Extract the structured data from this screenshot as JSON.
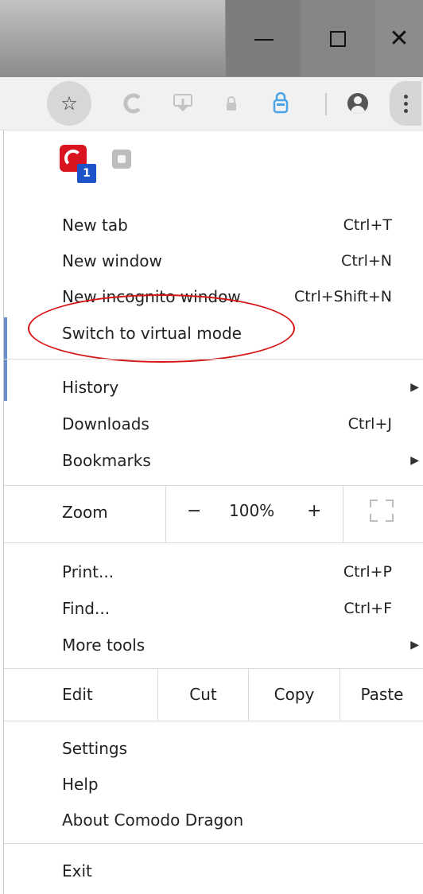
{
  "window": {
    "minimize_icon": "minimize-icon",
    "maximize_icon": "maximize-icon",
    "close_glyph": "✕"
  },
  "toolbar": {
    "star_glyph": "☆",
    "icons": [
      "refresh-icon",
      "download-icon",
      "lock-icon",
      "shield-icon",
      "account-icon",
      "menu-icon"
    ]
  },
  "extensions": {
    "badge": "1"
  },
  "menu": {
    "group1": [
      {
        "label": "New tab",
        "shortcut": "Ctrl+T"
      },
      {
        "label": "New window",
        "shortcut": "Ctrl+N"
      },
      {
        "label": "New incognito window",
        "shortcut": "Ctrl+Shift+N"
      },
      {
        "label": "Switch to virtual mode",
        "shortcut": ""
      }
    ],
    "group2": [
      {
        "label": "History",
        "shortcut": "",
        "submenu": true
      },
      {
        "label": "Downloads",
        "shortcut": "Ctrl+J"
      },
      {
        "label": "Bookmarks",
        "shortcut": "",
        "submenu": true
      }
    ],
    "zoom": {
      "label": "Zoom",
      "minus": "−",
      "value": "100%",
      "plus": "+"
    },
    "group3": [
      {
        "label": "Print...",
        "shortcut": "Ctrl+P"
      },
      {
        "label": "Find...",
        "shortcut": "Ctrl+F"
      },
      {
        "label": "More tools",
        "shortcut": "",
        "submenu": true
      }
    ],
    "edit": {
      "label": "Edit",
      "cut": "Cut",
      "copy": "Copy",
      "paste": "Paste"
    },
    "group4": [
      {
        "label": "Settings"
      },
      {
        "label": "Help"
      },
      {
        "label": "About Comodo Dragon"
      }
    ],
    "exit": "Exit",
    "submenu_arrow": "▶"
  },
  "colors": {
    "annotation_red": "#d81515",
    "badge_blue": "#1d54c9",
    "accent_bar": "#6a8fd0"
  }
}
